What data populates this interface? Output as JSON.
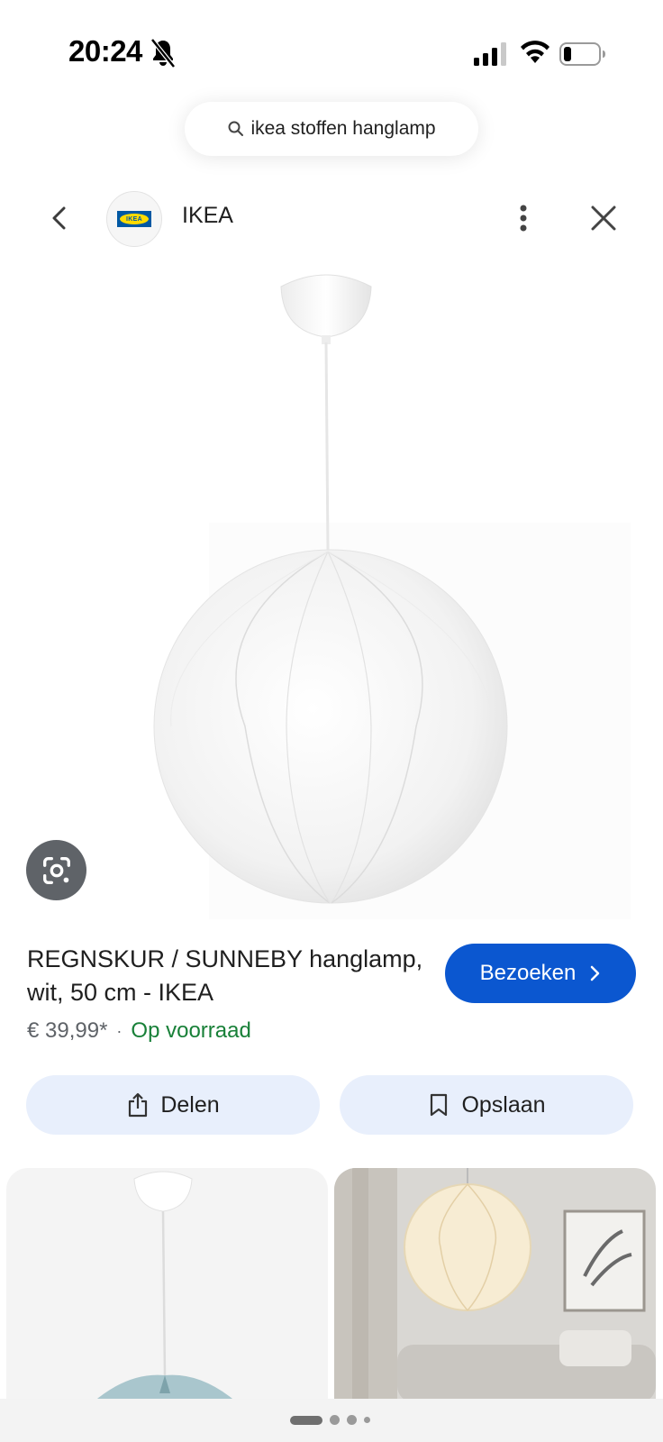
{
  "status_bar": {
    "time": "20:24",
    "icons": [
      "bell-muted-icon",
      "cellular-signal-icon",
      "wifi-icon",
      "battery-low-icon"
    ]
  },
  "search": {
    "query": "ikea stoffen hanglamp",
    "icon": "search-icon"
  },
  "header": {
    "back_icon": "chevron-left-icon",
    "site_logo_text": "IKEA",
    "site_name": "IKEA",
    "more_icon": "more-vert-icon",
    "close_icon": "close-icon"
  },
  "product": {
    "image": "white fabric globe pendant lamp",
    "lens_icon": "google-lens-icon",
    "title": "REGNSKUR / SUNNEBY hanglamp, wit, 50 cm - IKEA",
    "price": "€ 39,99*",
    "separator": "·",
    "stock": "Op voorraad",
    "stock_color": "#188038"
  },
  "actions": {
    "visit_label": "Bezoeken",
    "visit_color": "#0b57d0",
    "share_label": "Delen",
    "save_label": "Opslaan"
  },
  "related": [
    {
      "description": "pendant lamp with blue shade"
    },
    {
      "description": "globe lamp in living room"
    }
  ],
  "pager": {
    "count": 4,
    "active": 0
  }
}
